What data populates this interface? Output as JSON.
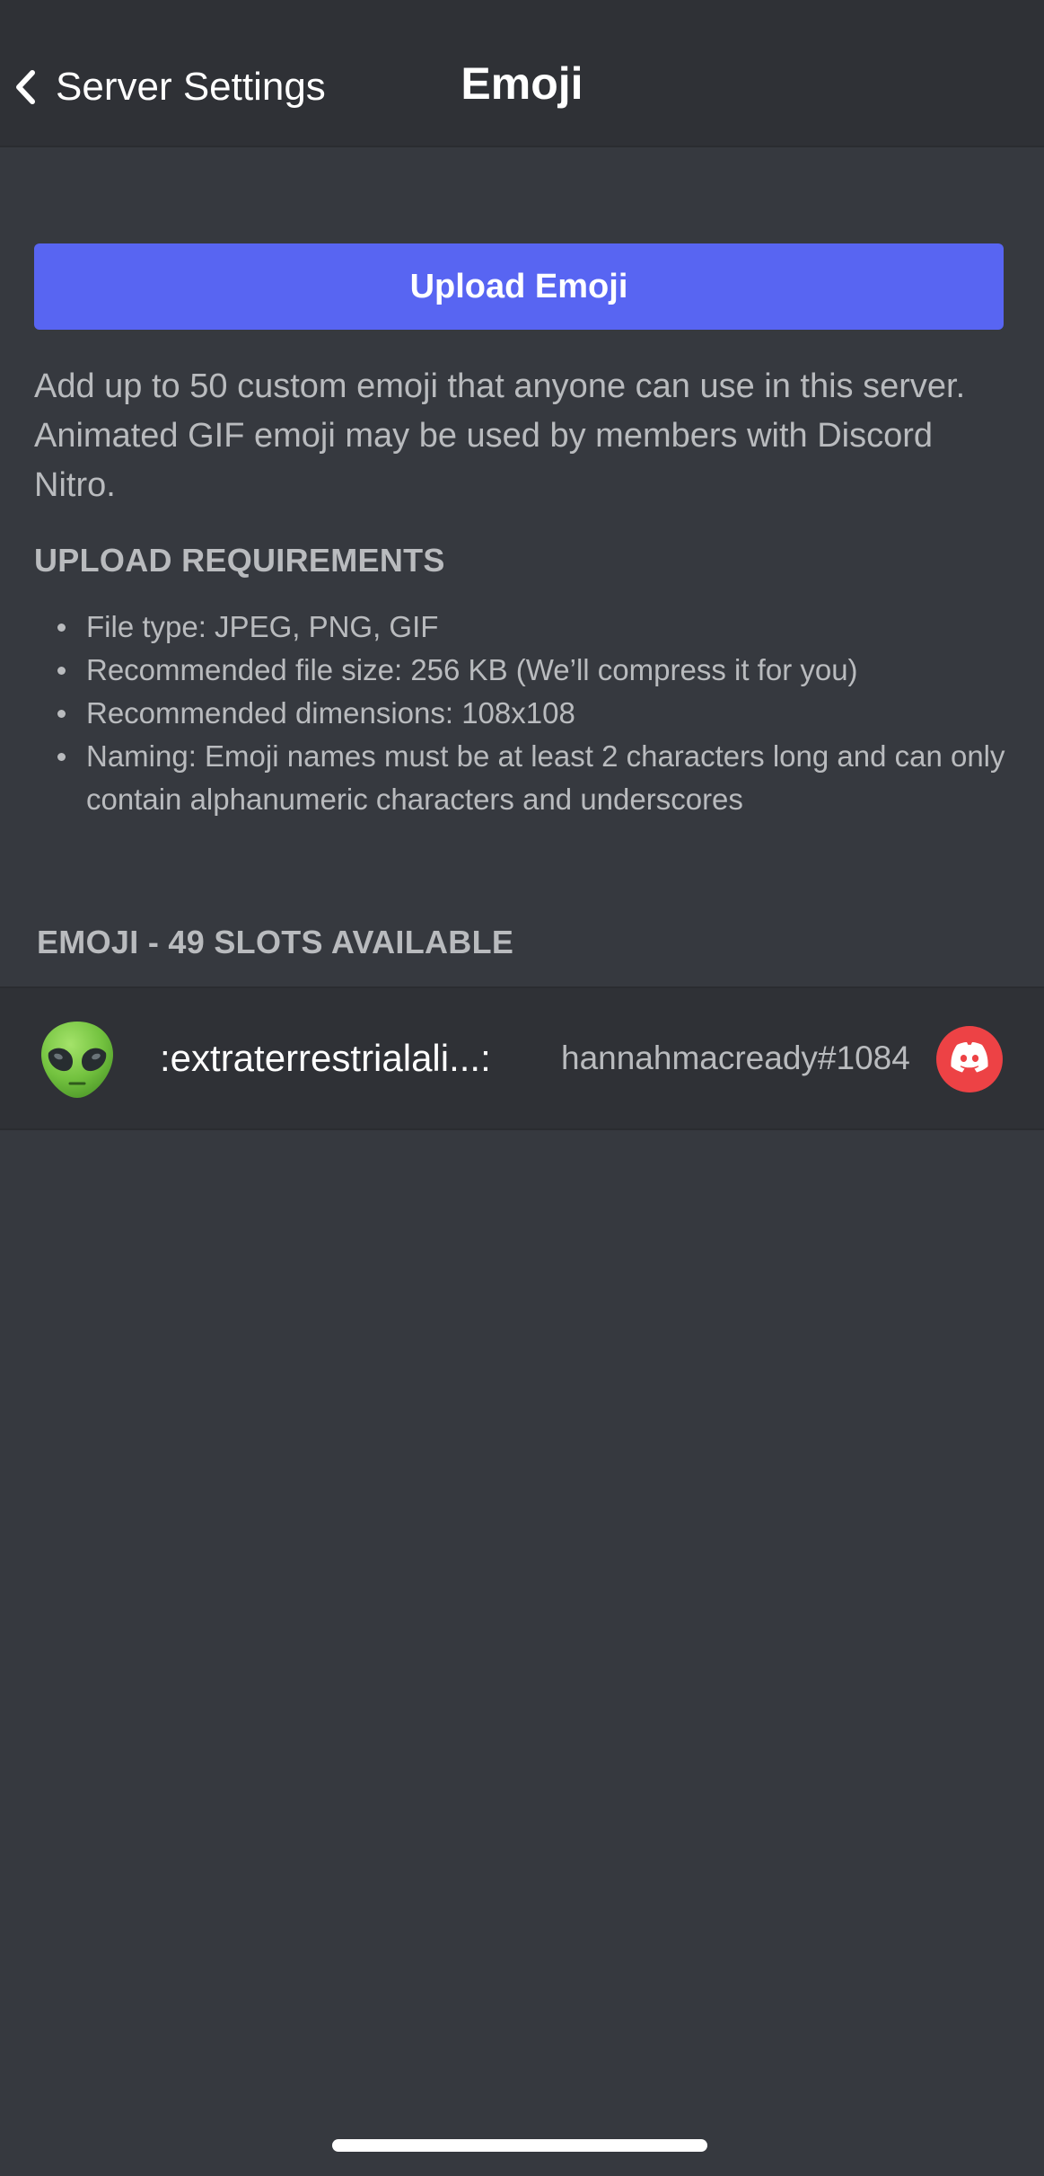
{
  "header": {
    "back_label": "Server Settings",
    "title": "Emoji",
    "back_icon": "chevron-left-icon"
  },
  "upload": {
    "button_label": "Upload Emoji"
  },
  "description": "Add up to 50 custom emoji that anyone can use in this server. Animated GIF emoji may be used by members with Discord Nitro.",
  "requirements": {
    "heading": "UPLOAD REQUIREMENTS",
    "items": [
      "File type: JPEG, PNG, GIF",
      "Recommended file size: 256 KB (We’ll compress it for you)",
      "Recommended dimensions: 108x108",
      "Naming: Emoji names must be at least 2 characters long and can only contain alphanumeric characters and underscores"
    ]
  },
  "emoji_list": {
    "heading": "EMOJI - 49 SLOTS AVAILABLE",
    "items": [
      {
        "icon": "alien-emoji",
        "name": ":extraterrestrialali...:",
        "uploader": "hannahmacready#1084",
        "avatar_icon": "discord-logo-icon"
      }
    ]
  },
  "colors": {
    "background": "#36393f",
    "header_background": "#2f3136",
    "accent": "#5865f2",
    "avatar": "#ed4245",
    "muted_text": "#b9bbbe"
  }
}
